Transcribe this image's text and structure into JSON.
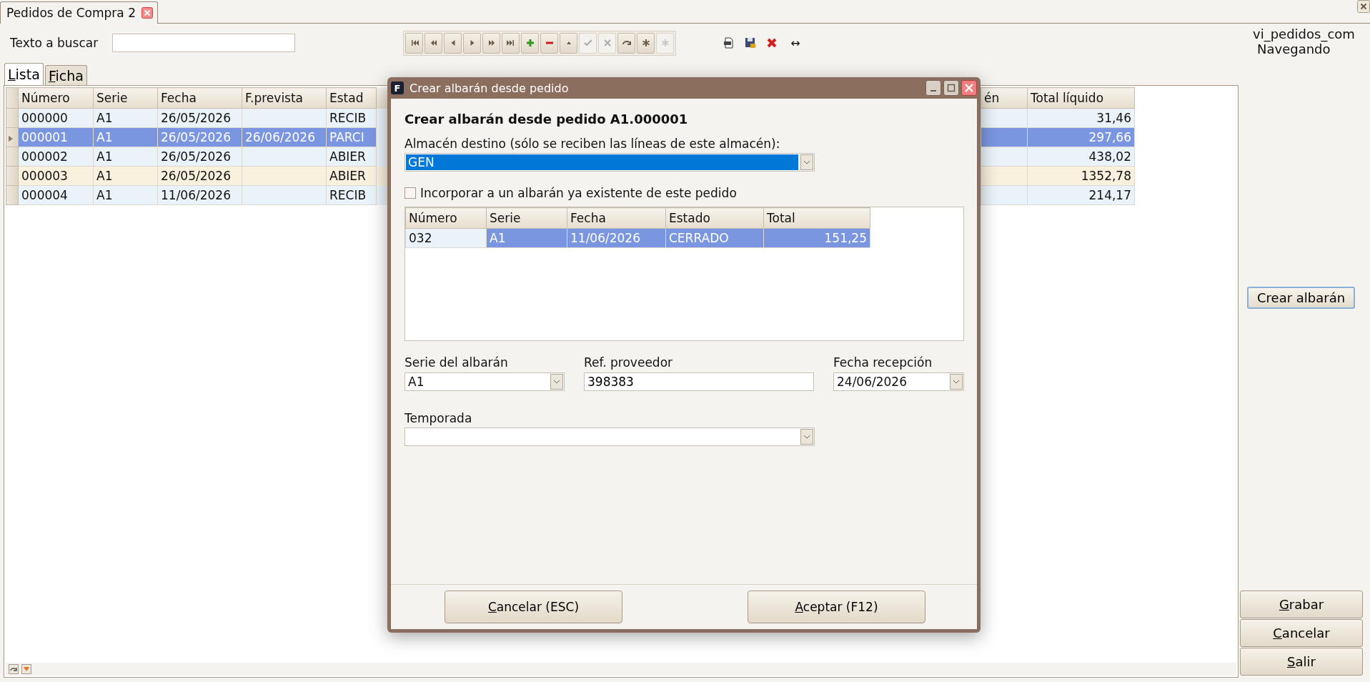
{
  "tab": {
    "title": "Pedidos de Compra 2"
  },
  "search": {
    "label": "Texto a buscar"
  },
  "toolbar": [
    {
      "kind": "first",
      "disabled": false
    },
    {
      "kind": "prev-page",
      "disabled": false
    },
    {
      "kind": "prev",
      "disabled": false
    },
    {
      "kind": "next",
      "disabled": false
    },
    {
      "kind": "next-page",
      "disabled": false
    },
    {
      "kind": "last",
      "disabled": false
    },
    {
      "kind": "add",
      "disabled": false
    },
    {
      "kind": "remove",
      "disabled": false
    },
    {
      "kind": "up",
      "disabled": false
    },
    {
      "kind": "confirm",
      "disabled": true
    },
    {
      "kind": "cancel",
      "disabled": true
    },
    {
      "kind": "refresh",
      "disabled": false
    },
    {
      "kind": "asterisk",
      "disabled": false
    },
    {
      "kind": "asterisk",
      "disabled": true
    }
  ],
  "extra_tools": [
    {
      "kind": "export"
    },
    {
      "kind": "save"
    },
    {
      "kind": "delete"
    },
    {
      "kind": "text",
      "text": "↔"
    }
  ],
  "view_name": "vi_pedidos_com",
  "mode": "Navegando",
  "subtabs": [
    {
      "label": "Lista",
      "selected": true
    },
    {
      "label": "Ficha",
      "selected": false
    }
  ],
  "table": {
    "columns_before_dialog": [
      "Número",
      "Serie",
      "Fecha",
      "F.prevista",
      "Estad"
    ],
    "columns_after_dialog": [
      "én",
      "Total líquido"
    ],
    "rows": [
      {
        "selected": false,
        "color": "#eaf3fa",
        "numero": "000000",
        "serie": "A1",
        "fecha": "26/05/2026",
        "estado": "RECIB",
        "total_liquido": "31,46"
      },
      {
        "selected": true,
        "color": "#eaf3fa",
        "numero": "000001",
        "serie": "A1",
        "fecha": "26/05/2026",
        "f_prevista": "26/06/2026",
        "estado": "PARCI",
        "total_liquido": "297,66"
      },
      {
        "selected": false,
        "color": "#eaf3fa",
        "numero": "000002",
        "serie": "A1",
        "fecha": "26/05/2026",
        "estado": "ABIER",
        "total_liquido": "438,02"
      },
      {
        "selected": false,
        "color": "#faf0de",
        "numero": "000003",
        "serie": "A1",
        "fecha": "26/05/2026",
        "estado": "ABIER",
        "total_liquido": "1352,78"
      },
      {
        "selected": false,
        "color": "#eaf3fa",
        "numero": "000004",
        "serie": "A1",
        "fecha": "11/06/2026",
        "estado": "RECIB",
        "total_liquido": "214,17"
      }
    ]
  },
  "side_buttons": {
    "create": "Crear albarán",
    "bottom": [
      "Grabar",
      "Cancelar",
      "Salir"
    ]
  },
  "dialog": {
    "icon_text": "F",
    "title": "Crear albarán desde pedido",
    "heading": "Crear albarán desde pedido A1.000001",
    "warehouse_label": "Almacén destino (sólo se reciben las líneas de este almacén):",
    "warehouse_value": "GEN",
    "existing": {
      "label": "Incorporar a un albarán ya existente de este pedido",
      "checked": false
    },
    "table": {
      "columns": [
        "Número",
        "Serie",
        "Fecha",
        "Estado",
        "Total"
      ],
      "rows": [
        {
          "selected": true,
          "cells": [
            {
              "text": "032",
              "focused": true
            },
            {
              "text": "A1",
              "focused": false
            },
            {
              "text": "11/06/2026",
              "focused": false
            },
            {
              "text": "CERRADO",
              "focused": false
            },
            {
              "text": "151,25",
              "focused": false
            }
          ]
        }
      ]
    },
    "serie_label": "Serie del albarán",
    "serie_value": "A1",
    "ref_label": "Ref. proveedor",
    "ref_value": "398383",
    "date_label": "Fecha recepción",
    "date_value": "24/06/2026",
    "season_label": "Temporada",
    "buttons": [
      "Cancelar (ESC)",
      "Aceptar (F12)"
    ]
  }
}
